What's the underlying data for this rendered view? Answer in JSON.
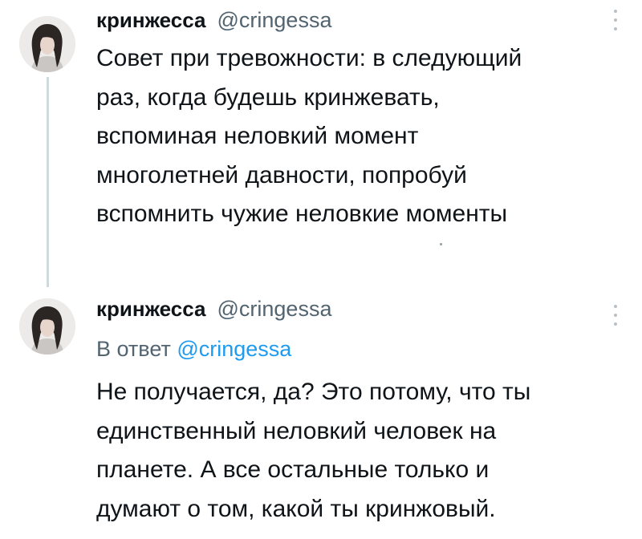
{
  "tweets": [
    {
      "display_name": "кринжесса",
      "handle": "@cringessa",
      "text_lines": [
        "Совет при тревожности: в следующий",
        "раз, когда будешь кринжевать,",
        "вспоминая неловкий момент",
        "многолетней давности, попробуй",
        "вспомнить чужие неловкие моменты"
      ]
    },
    {
      "display_name": "кринжесса",
      "handle": "@cringessa",
      "reply_prefix": "В ответ",
      "reply_handle": "@cringessa",
      "text_lines": [
        "Не получается, да? Это потому, что ты",
        "единственный неловкий человек на",
        "планете. А все остальные только и",
        "думают о том, какой ты кринжовый."
      ]
    }
  ],
  "icons": {
    "more": "more-vertical-icon",
    "avatar": "avatar-photo"
  },
  "colors": {
    "text": "#0f1419",
    "secondary": "#536471",
    "link": "#1d9bf0",
    "thread_line": "#cfd9de"
  }
}
